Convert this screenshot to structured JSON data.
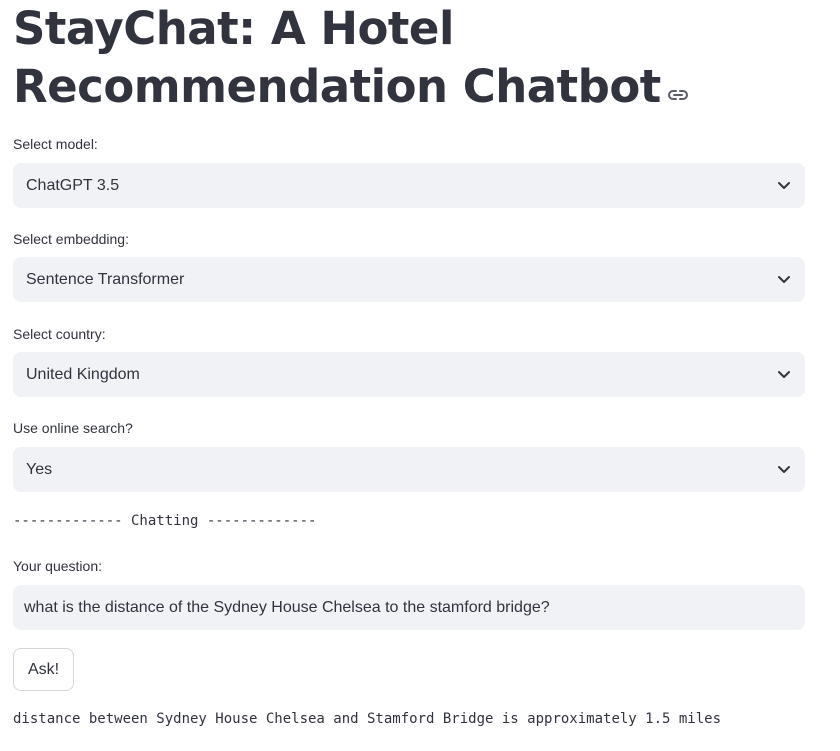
{
  "title": {
    "text": "StayChat: A Hotel Recommendation Chatbot",
    "link_icon": "link-icon"
  },
  "model": {
    "label": "Select model:",
    "value": "ChatGPT 3.5"
  },
  "embedding": {
    "label": "Select embedding:",
    "value": "Sentence Transformer"
  },
  "country": {
    "label": "Select country:",
    "value": "United Kingdom"
  },
  "online_search": {
    "label": "Use online search?",
    "value": "Yes"
  },
  "chat_divider": "------------- Chatting -------------",
  "question": {
    "label": "Your question:",
    "value": "what is the distance of the Sydney House Chelsea to the stamford bridge?"
  },
  "ask_button": "Ask!",
  "answer": "distance between Sydney House Chelsea and Stamford Bridge is approximately 1.5 miles",
  "colors": {
    "field_bg": "#f0f2f6",
    "text": "#31333f"
  },
  "icons": {
    "dropdown": "chevron-down-icon"
  }
}
